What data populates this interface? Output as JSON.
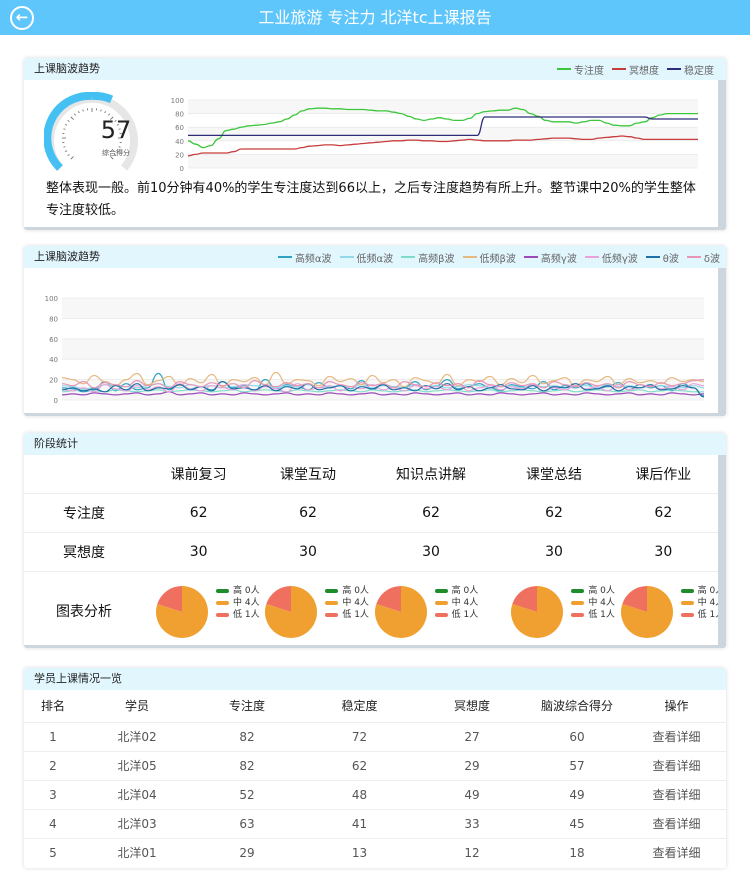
{
  "header": {
    "title": "工业旅游 专注力 北洋tc上课报告",
    "back_icon": "back-arrow-icon"
  },
  "colors": {
    "header_bg": "#5fc6fb",
    "focus": "#3cc63c",
    "meditation": "#c83c3c",
    "stability": "#2d2d7a"
  },
  "trend": {
    "title": "上课脑波趋势",
    "legend": [
      "专注度",
      "冥想度",
      "稳定度"
    ],
    "score": "57",
    "score_label": "综合得分",
    "summary": "整体表现一般。前10分钟有40%的学生专注度达到66以上，之后专注度趋势有所上升。整节课中20%的学生整体专注度较低。",
    "chart_data": {
      "type": "line",
      "x_count": 60,
      "ylim": [
        0,
        100
      ],
      "yticks": [
        "100",
        "80",
        "60",
        "40",
        "20",
        "0"
      ],
      "series": [
        {
          "name": "专注度",
          "color": "#3cc63c",
          "values": [
            40,
            35,
            30,
            33,
            43,
            55,
            57,
            60,
            62,
            63,
            64,
            66,
            68,
            72,
            78,
            84,
            87,
            88,
            88,
            87,
            87,
            86,
            86,
            86,
            85,
            84,
            84,
            82,
            80,
            76,
            72,
            70,
            72,
            74,
            72,
            70,
            70,
            73,
            80,
            83,
            84,
            85,
            85,
            88,
            86,
            80,
            76,
            70,
            68,
            68,
            68,
            66,
            68,
            70,
            70,
            66,
            63,
            62,
            62,
            66,
            68,
            74,
            78,
            80,
            80,
            80,
            80,
            80
          ]
        },
        {
          "name": "冥想度",
          "color": "#c83c3c",
          "values": [
            18,
            20,
            22,
            22,
            22,
            22,
            24,
            28,
            28,
            28,
            28,
            28,
            28,
            28,
            28,
            30,
            32,
            33,
            34,
            34,
            33,
            34,
            35,
            36,
            37,
            38,
            39,
            40,
            40,
            41,
            41,
            40,
            40,
            39,
            39,
            40,
            41,
            42,
            41,
            40,
            40,
            40,
            40,
            41,
            41,
            41,
            42,
            43,
            44,
            44,
            44,
            43,
            42,
            42,
            44,
            45,
            46,
            47,
            46,
            44,
            42,
            42,
            42,
            42,
            42,
            42,
            42,
            42
          ]
        },
        {
          "name": "稳定度",
          "color": "#2d2d7a",
          "values": [
            48,
            48,
            48,
            48,
            48,
            48,
            48,
            48,
            48,
            48,
            48,
            48,
            48,
            48,
            48,
            48,
            48,
            48,
            48,
            48,
            48,
            48,
            48,
            48,
            48,
            48,
            48,
            48,
            48,
            48,
            48,
            48,
            48,
            48,
            48,
            48,
            48,
            48,
            48,
            75,
            75,
            75,
            75,
            75,
            75,
            75,
            75,
            75,
            75,
            75,
            75,
            75,
            75,
            75,
            75,
            75,
            75,
            75,
            75,
            75,
            75,
            72,
            72,
            72,
            72,
            72,
            72,
            72
          ]
        }
      ]
    }
  },
  "waves": {
    "title": "上课脑波趋势",
    "legend": [
      "高频α波",
      "低频α波",
      "高频β波",
      "低频β波",
      "高频γ波",
      "低频γ波",
      "θ波",
      "δ波"
    ],
    "chart_data": {
      "type": "line",
      "ylim": [
        0,
        100
      ],
      "yticks": [
        "100",
        "80",
        "60",
        "40",
        "20",
        "0"
      ],
      "series": [
        {
          "name": "高频α波",
          "color": "#2fa1c4",
          "values": [
            12,
            11,
            8,
            10,
            18,
            9,
            16,
            10,
            12,
            26,
            10,
            15,
            11,
            13,
            10,
            18,
            12,
            14,
            9,
            20,
            11,
            15,
            13,
            10,
            17,
            12,
            14,
            11,
            19,
            10,
            15,
            13,
            12,
            18,
            10,
            14,
            20,
            11,
            13,
            16,
            12,
            9,
            15,
            13,
            11,
            18,
            10,
            14,
            12,
            16,
            11,
            13,
            17,
            10,
            15,
            12,
            14,
            9,
            16,
            12,
            4
          ]
        },
        {
          "name": "低频α波",
          "color": "#8fd9e8",
          "values": [
            14,
            13,
            11,
            12,
            15,
            14,
            13,
            12,
            14,
            16,
            13,
            12,
            15,
            13,
            14,
            12,
            13,
            15,
            14,
            13,
            12,
            14,
            13,
            15,
            12,
            13,
            14,
            13,
            15,
            12,
            14,
            13,
            12,
            15,
            13,
            14,
            12,
            13,
            15,
            14,
            12,
            13,
            14,
            12,
            15,
            13,
            14,
            12,
            13,
            14,
            12,
            15,
            13,
            14,
            12,
            13,
            14,
            13,
            12,
            14,
            12
          ]
        },
        {
          "name": "高频β波",
          "color": "#7fdcc9",
          "values": [
            8,
            9,
            10,
            9,
            8,
            10,
            9,
            8,
            9,
            10,
            8,
            9,
            10,
            9,
            8,
            9,
            10,
            8,
            9,
            10,
            9,
            8,
            10,
            9,
            8,
            9,
            10,
            9,
            8,
            10,
            9,
            8,
            9,
            10,
            8,
            9,
            10,
            9,
            8,
            9,
            10,
            8,
            9,
            10,
            9,
            8,
            9,
            10,
            8,
            9,
            10,
            9,
            8,
            9,
            10,
            8,
            9,
            10,
            9,
            8,
            8
          ]
        },
        {
          "name": "低频β波",
          "color": "#e6b982",
          "values": [
            22,
            20,
            16,
            24,
            18,
            14,
            20,
            26,
            15,
            19,
            23,
            14,
            21,
            17,
            25,
            13,
            20,
            18,
            22,
            15,
            27,
            16,
            20,
            19,
            14,
            23,
            18,
            21,
            15,
            24,
            17,
            20,
            13,
            22,
            19,
            16,
            25,
            14,
            20,
            18,
            23,
            15,
            21,
            17,
            24,
            16,
            19,
            22,
            14,
            20,
            18,
            23,
            15,
            21,
            17,
            19,
            16,
            22,
            18,
            20,
            18
          ]
        },
        {
          "name": "高频γ波",
          "color": "#9d49b8",
          "values": [
            5,
            6,
            5,
            7,
            6,
            5,
            6,
            7,
            5,
            6,
            8,
            5,
            6,
            7,
            5,
            6,
            5,
            7,
            6,
            5,
            6,
            7,
            5,
            6,
            5,
            7,
            6,
            5,
            6,
            7,
            5,
            6,
            5,
            7,
            6,
            5,
            6,
            7,
            5,
            6,
            5,
            7,
            6,
            5,
            6,
            7,
            5,
            6,
            5,
            7,
            6,
            5,
            6,
            7,
            5,
            6,
            5,
            7,
            6,
            5,
            6
          ]
        },
        {
          "name": "低频γ波",
          "color": "#e9a2d8",
          "values": [
            10,
            9,
            12,
            8,
            15,
            11,
            9,
            14,
            10,
            13,
            8,
            16,
            11,
            9,
            14,
            12,
            10,
            15,
            9,
            13,
            11,
            8,
            16,
            10,
            12,
            14,
            9,
            13,
            11,
            15,
            10,
            12,
            9,
            14,
            11,
            13,
            10,
            16,
            9,
            12,
            14,
            10,
            13,
            11,
            15,
            9,
            12,
            10,
            14,
            11,
            13,
            9,
            15,
            10,
            12,
            14,
            11,
            13,
            10,
            16,
            14
          ]
        },
        {
          "name": "θ波",
          "color": "#1f6fa8",
          "values": [
            10,
            12,
            9,
            11,
            8,
            14,
            10,
            16,
            9,
            12,
            11,
            15,
            10,
            13,
            9,
            18,
            11,
            12,
            10,
            14,
            9,
            13,
            11,
            16,
            10,
            12,
            14,
            9,
            13,
            11,
            15,
            10,
            12,
            9,
            14,
            11,
            16,
            10,
            13,
            9,
            12,
            15,
            11,
            10,
            14,
            9,
            13,
            12,
            16,
            10,
            11,
            14,
            9,
            13,
            12,
            15,
            10,
            11,
            14,
            12,
            3
          ]
        },
        {
          "name": "δ波",
          "color": "#e596b4",
          "values": [
            16,
            14,
            18,
            12,
            17,
            15,
            13,
            19,
            14,
            16,
            12,
            18,
            15,
            13,
            17,
            14,
            16,
            12,
            19,
            15,
            13,
            17,
            14,
            16,
            12,
            18,
            15,
            13,
            17,
            14,
            16,
            12,
            18,
            15,
            13,
            17,
            14,
            16,
            12,
            19,
            15,
            13,
            17,
            14,
            16,
            12,
            18,
            15,
            13,
            17,
            14,
            16,
            12,
            18,
            15,
            13,
            17,
            14,
            16,
            19,
            20
          ]
        }
      ]
    }
  },
  "stages": {
    "title": "阶段统计",
    "columns": [
      "课前复习",
      "课堂互动",
      "知识点讲解",
      "课堂总结",
      "课后作业"
    ],
    "focus_label": "专注度",
    "focus": [
      "62",
      "62",
      "62",
      "62",
      "62"
    ],
    "meditation_label": "冥想度",
    "meditation": [
      "30",
      "30",
      "30",
      "30",
      "30"
    ],
    "chart_label": "图表分析",
    "pie_legend": [
      {
        "label": "高 0人",
        "color": "#1e8c2a"
      },
      {
        "label": "中 4人",
        "color": "#f0a030"
      },
      {
        "label": "低 1人",
        "color": "#f07060"
      }
    ],
    "pie_values": [
      0,
      4,
      1
    ]
  },
  "students": {
    "title": "学员上课情况一览",
    "headers": [
      "排名",
      "学员",
      "专注度",
      "稳定度",
      "冥想度",
      "脑波综合得分",
      "操作"
    ],
    "rows": [
      {
        "rank": "1",
        "name": "北洋02",
        "focus": "82",
        "stability": "72",
        "meditation": "27",
        "score": "60",
        "action": "查看详细"
      },
      {
        "rank": "2",
        "name": "北洋05",
        "focus": "82",
        "stability": "62",
        "meditation": "29",
        "score": "57",
        "action": "查看详细"
      },
      {
        "rank": "3",
        "name": "北洋04",
        "focus": "52",
        "stability": "48",
        "meditation": "49",
        "score": "49",
        "action": "查看详细"
      },
      {
        "rank": "4",
        "name": "北洋03",
        "focus": "63",
        "stability": "41",
        "meditation": "33",
        "score": "45",
        "action": "查看详细"
      },
      {
        "rank": "5",
        "name": "北洋01",
        "focus": "29",
        "stability": "13",
        "meditation": "12",
        "score": "18",
        "action": "查看详细"
      }
    ]
  }
}
